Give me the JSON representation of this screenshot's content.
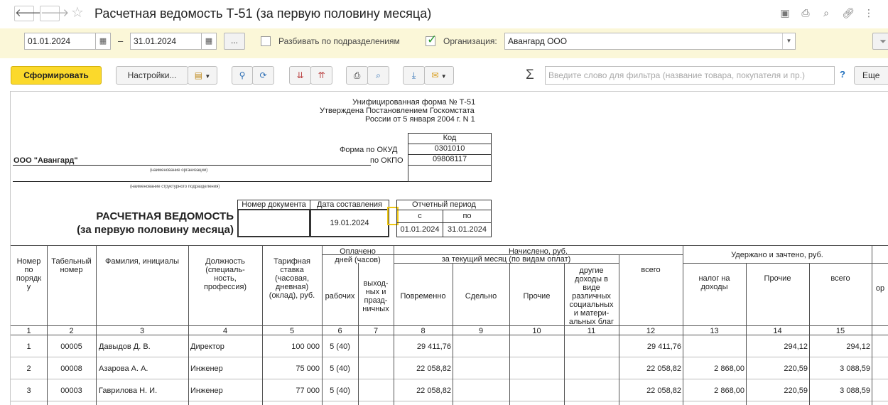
{
  "window": {
    "title": "Расчетная ведомость Т-51 (за первую половину месяца)"
  },
  "filters": {
    "date_from": "01.01.2024",
    "date_to": "31.01.2024",
    "dash": "–",
    "dots": "...",
    "split_label": "Разбивать по подразделениям",
    "org_label": "Организация:",
    "org_value": "Авангард ООО"
  },
  "toolbar": {
    "generate": "Сформировать",
    "settings": "Настройки...",
    "search_placeholder": "Введите слово для фильтра (название товара, покупателя и пр.)",
    "help": "?",
    "more": "Еще"
  },
  "report": {
    "form_line1": "Унифицированная форма № Т-51",
    "form_line2": "Утверждена Постановлением Госкомстата",
    "form_line3": "России от 5 января 2004 г. N 1",
    "code_header": "Код",
    "okud_label": "Форма по ОКУД",
    "okud_value": "0301010",
    "okpo_label": "по ОКПО",
    "okpo_value": "09808117",
    "org_name": "ООО \"Авангард\"",
    "org_caption": "(наименование организации)",
    "dept_caption": "(наименование структурного подразделения)",
    "doc_number_header": "Номер документа",
    "doc_date_header": "Дата составления",
    "doc_date": "19.01.2024",
    "period_header": "Отчетный период",
    "period_from_label": "с",
    "period_to_label": "по",
    "period_from": "01.01.2024",
    "period_to": "31.01.2024",
    "title_line1": "РАСЧЕТНАЯ ВЕДОМОСТЬ",
    "title_line2": "(за первую половину месяца)"
  },
  "table": {
    "h_num": "Номер\nпо\nпорядк\nу",
    "h_tab": "Табельный\nномер",
    "h_name": "Фамилия, инициалы",
    "h_pos": "Должность\n(специаль-\nность,\nпрофессия)",
    "h_rate": "Тарифная\nставка\n(часовая,\nдневная)\n(оклад), руб.",
    "h_paid": "Оплачено\nдней (часов)",
    "h_work": "рабочих",
    "h_off": "выход-\nных и\nпразд-\nничных",
    "h_accrued": "Начислено, руб.",
    "h_current": "за текущий месяц (по видам оплат)",
    "h_time": "Повременно",
    "h_piece": "Сдельно",
    "h_other": "Прочие",
    "h_benefits": "другие\nдоходы в\nвиде\nразличных\nсоциальных\nи матери-\nальных благ",
    "h_total": "всего",
    "h_withheld": "Удержано и зачтено, руб.",
    "h_tax": "налог на\nдоходы",
    "h_other2": "Прочие",
    "h_total2": "всего",
    "h_cut": "ор",
    "col_numbers": [
      "1",
      "2",
      "3",
      "4",
      "5",
      "6",
      "7",
      "8",
      "9",
      "10",
      "11",
      "12",
      "13",
      "14",
      "15"
    ],
    "rows": [
      {
        "n": "1",
        "tab": "00005",
        "name": "Давыдов Д. В.",
        "pos": "Директор",
        "rate": "100 000",
        "days": "5 (40)",
        "time": "29 411,76",
        "total": "29 411,76",
        "tax": "",
        "other": "294,12",
        "wtotal": "294,12"
      },
      {
        "n": "2",
        "tab": "00008",
        "name": "Азарова А. А.",
        "pos": "Инженер",
        "rate": "75 000",
        "days": "5 (40)",
        "time": "22 058,82",
        "total": "22 058,82",
        "tax": "2 868,00",
        "other": "220,59",
        "wtotal": "3 088,59"
      },
      {
        "n": "3",
        "tab": "00003",
        "name": "Гаврилова Н. И.",
        "pos": "Инженер",
        "rate": "77 000",
        "days": "5 (40)",
        "time": "22 058,82",
        "total": "22 058,82",
        "tax": "2 868,00",
        "other": "220,59",
        "wtotal": "3 088,59"
      }
    ]
  }
}
